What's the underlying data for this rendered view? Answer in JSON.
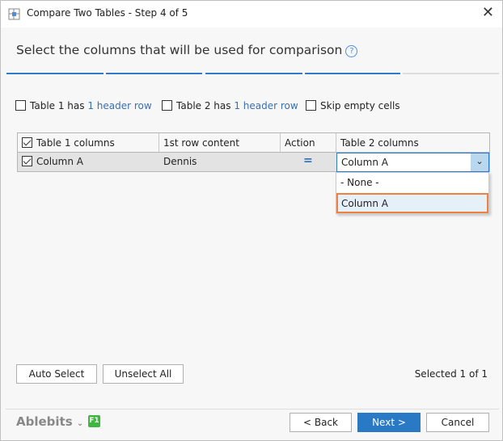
{
  "window": {
    "title": "Compare Two Tables - Step 4 of 5",
    "close": "✕"
  },
  "heading": "Select the columns that will be used for comparison",
  "help": "?",
  "options": {
    "t1_label": "Table 1  has",
    "t1_link": "1 header row",
    "t2_label": "Table 2 has",
    "t2_link": "1 header row",
    "skip": "Skip empty cells"
  },
  "table": {
    "headers": [
      "Table 1 columns",
      "1st row content",
      "Action",
      "Table 2 columns"
    ],
    "row": {
      "col": "Column A",
      "content": "Dennis",
      "action": "=",
      "table2": "Column A"
    }
  },
  "dropdown": {
    "options": [
      "- None -",
      "Column A"
    ],
    "selected": "Column A"
  },
  "buttons": {
    "auto": "Auto Select",
    "unselect": "Unselect All",
    "back": "< Back",
    "next": "Next >",
    "cancel": "Cancel"
  },
  "status": "Selected 1 of 1",
  "brand": "Ablebits",
  "f1": "F1"
}
